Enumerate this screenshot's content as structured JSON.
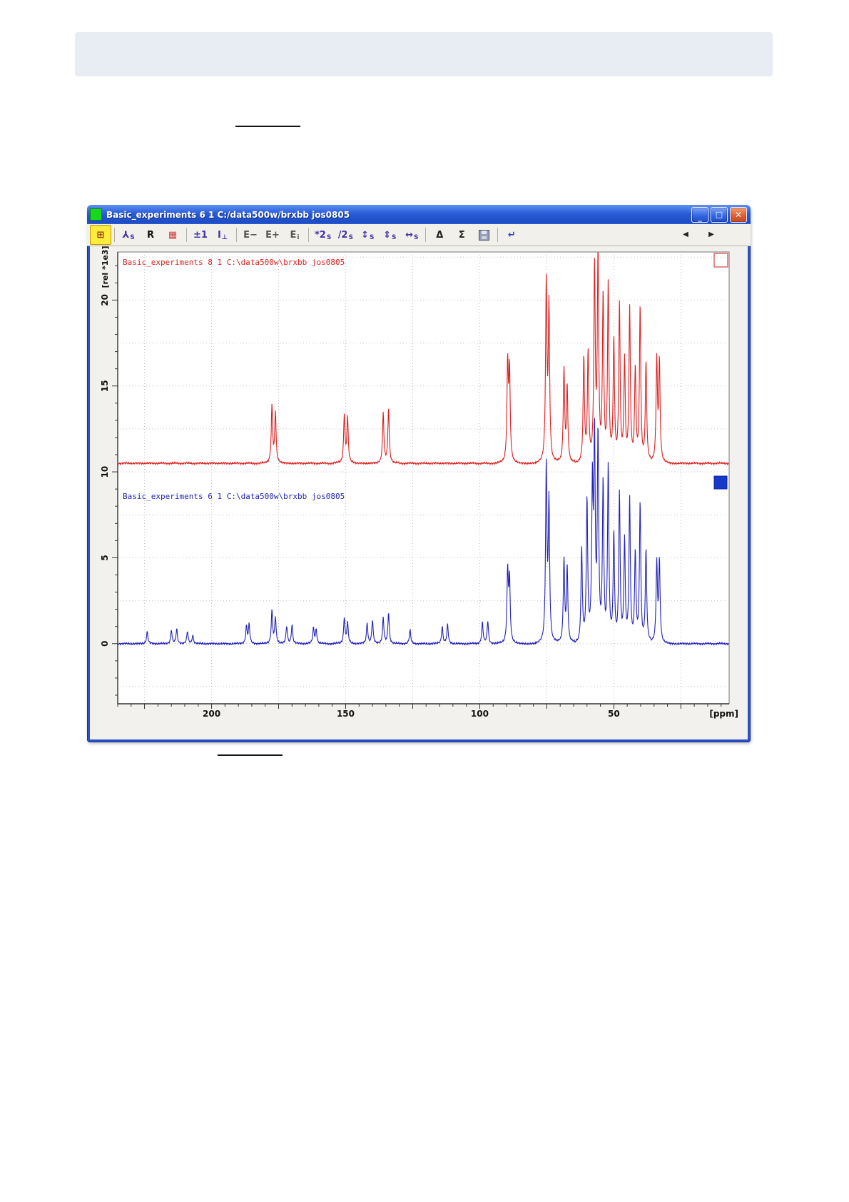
{
  "page": {
    "header_band": "empty-light-band",
    "underlines": [
      "link-underline-above-window",
      "link-underline-below-window"
    ]
  },
  "window": {
    "title": "Basic_experiments 6 1 C:/data500w/brxbb jos0805",
    "title_icon": "green-square-icon",
    "controls": {
      "minimize": "_",
      "maximize": "□",
      "close": "✕"
    }
  },
  "toolbar": {
    "items": [
      {
        "name": "exit-multiple-display-button",
        "glyph": "⊞",
        "color": "#993300",
        "active": true
      },
      {
        "sep": true
      },
      {
        "name": "separate-stack-button",
        "glyph": "⅄",
        "sub": "S",
        "color": "#4433aa"
      },
      {
        "name": "reset-scaling-button",
        "glyph": "R",
        "color": "#111111"
      },
      {
        "name": "remove-dataset-button",
        "glyph": "▦",
        "color": "#cc4444"
      },
      {
        "sep": true
      },
      {
        "name": "shift-spectrum-button",
        "glyph": "±1",
        "color": "#4433aa"
      },
      {
        "name": "align-baseline-button",
        "glyph": "I",
        "sub": "⊥",
        "color": "#4433aa"
      },
      {
        "sep": true
      },
      {
        "name": "expand-left-button",
        "glyph": "E−",
        "color": "#555555"
      },
      {
        "name": "expand-right-button",
        "glyph": "E+",
        "color": "#555555"
      },
      {
        "name": "expand-initial-button",
        "glyph": "E",
        "sub": "i",
        "color": "#555555"
      },
      {
        "sep": true
      },
      {
        "name": "scale-times2-button",
        "glyph": "*2",
        "sub": "S",
        "color": "#4433aa"
      },
      {
        "name": "scale-div2-button",
        "glyph": "/2",
        "sub": "S",
        "color": "#4433aa"
      },
      {
        "name": "shift-up-down-button",
        "glyph": "↕",
        "sub": "S",
        "color": "#4433aa"
      },
      {
        "name": "scale-vertical-button",
        "glyph": "⇕",
        "sub": "S",
        "color": "#4433aa"
      },
      {
        "name": "shift-left-right-button",
        "glyph": "↔",
        "sub": "S",
        "color": "#4433aa"
      },
      {
        "sep": true
      },
      {
        "name": "difference-button",
        "glyph": "Δ",
        "color": "#222222"
      },
      {
        "name": "sum-button",
        "glyph": "Σ",
        "color": "#222222"
      },
      {
        "name": "save-button",
        "floppy": true
      },
      {
        "sep": true
      },
      {
        "name": "return-button",
        "glyph": "↵",
        "color": "#3344cc"
      }
    ],
    "nav": [
      {
        "name": "scroll-left-button",
        "glyph": "◀"
      },
      {
        "name": "scroll-right-button",
        "glyph": "▶"
      }
    ]
  },
  "chart_data": {
    "type": "line",
    "title": "",
    "xlabel": "[ppm]",
    "ylabel": "[rel *1e3]",
    "x_axis": {
      "min": 7,
      "max": 235,
      "reversed": true,
      "tick_labels": [
        200,
        150,
        100,
        50
      ],
      "grid_step": 25,
      "minor_step": 5
    },
    "y_axis": {
      "min": -3.5,
      "max": 22.8,
      "tick_labels": [
        0,
        5,
        10,
        15,
        20
      ],
      "grid_step": 2.5,
      "minor_step": 1
    },
    "grid": "dotted",
    "series": [
      {
        "name": "spectrum-red",
        "label": "Basic_experiments  8  1  C:\\data500w\\brxbb  jos0805",
        "color": "#dd2020",
        "offset": 10.5,
        "peaks": [
          [
            177.5,
            3.3
          ],
          [
            176.2,
            2.9
          ],
          [
            150.5,
            2.8
          ],
          [
            149.3,
            2.6
          ],
          [
            136,
            2.9
          ],
          [
            134,
            3.2
          ],
          [
            89.6,
            5.6
          ],
          [
            88.9,
            5.2
          ],
          [
            75.2,
            10.4
          ],
          [
            74.2,
            8.9
          ],
          [
            68.6,
            5.5
          ],
          [
            67.4,
            4.4
          ],
          [
            61.2,
            6.1
          ],
          [
            59.6,
            6.3
          ],
          [
            57.2,
            11.3
          ],
          [
            55.9,
            11.9
          ],
          [
            54,
            9.6
          ],
          [
            52.1,
            10.3
          ],
          [
            50,
            7.1
          ],
          [
            47.9,
            9.2
          ],
          [
            46,
            5.9
          ],
          [
            44.1,
            8.9
          ],
          [
            42,
            5.4
          ],
          [
            40.2,
            9.0
          ],
          [
            38,
            5.8
          ],
          [
            34,
            5.9
          ],
          [
            33,
            5.8
          ]
        ]
      },
      {
        "name": "spectrum-blue",
        "label": "Basic_experiments  6  1  C:\\data500w\\brxbb  jos0805",
        "color": "#2222bb",
        "offset": 0,
        "peaks": [
          [
            224,
            0.7
          ],
          [
            215,
            0.8
          ],
          [
            213,
            0.85
          ],
          [
            209,
            0.7
          ],
          [
            207,
            0.5
          ],
          [
            187,
            1.0
          ],
          [
            186,
            1.1
          ],
          [
            177.5,
            1.9
          ],
          [
            176.2,
            1.5
          ],
          [
            172,
            1.0
          ],
          [
            170,
            1.1
          ],
          [
            162,
            0.9
          ],
          [
            161,
            0.8
          ],
          [
            150.5,
            1.5
          ],
          [
            149.3,
            1.2
          ],
          [
            142,
            1.2
          ],
          [
            140,
            1.35
          ],
          [
            136,
            1.5
          ],
          [
            134,
            1.8
          ],
          [
            126,
            0.8
          ],
          [
            114,
            1.0
          ],
          [
            112,
            1.1
          ],
          [
            99,
            1.25
          ],
          [
            97,
            1.3
          ],
          [
            89.6,
            4.1
          ],
          [
            88.9,
            3.6
          ],
          [
            75.2,
            10.2
          ],
          [
            74.2,
            8.0
          ],
          [
            68.6,
            4.9
          ],
          [
            67.4,
            4.4
          ],
          [
            62,
            5.5
          ],
          [
            60,
            8.3
          ],
          [
            58,
            8.7
          ],
          [
            57.2,
            11.5
          ],
          [
            55.9,
            11.9
          ],
          [
            54,
            9.2
          ],
          [
            52.1,
            10.2
          ],
          [
            50,
            6.3
          ],
          [
            47.9,
            8.7
          ],
          [
            46,
            5.9
          ],
          [
            44.1,
            8.3
          ],
          [
            42,
            5.2
          ],
          [
            40.2,
            8.1
          ],
          [
            38,
            5.4
          ],
          [
            34,
            4.6
          ],
          [
            33,
            4.7
          ]
        ]
      }
    ],
    "markers": [
      {
        "name": "dataset-marker-red",
        "type": "outline",
        "color": "#e87070"
      },
      {
        "name": "dataset-marker-blue",
        "type": "filled",
        "color": "#1838cc"
      }
    ]
  }
}
